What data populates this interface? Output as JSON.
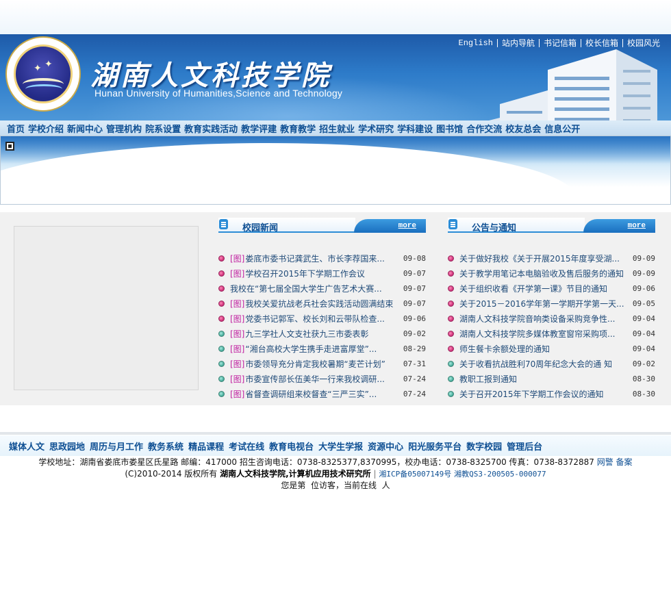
{
  "header": {
    "title_cn": "湖南人文科技学院",
    "title_en": "Hunan University of Humanities,Science and Technology",
    "top_links": [
      "English",
      "站内导航",
      "书记信箱",
      "校长信箱",
      "校园风光"
    ]
  },
  "nav": {
    "items": [
      "首页",
      "学校介绍",
      "新闻中心",
      "管理机构",
      "院系设置",
      "教育实践活动",
      "教学评建",
      "教育教学",
      "招生就业",
      "学术研究",
      "学科建设",
      "图书馆",
      "合作交流",
      "校友总会",
      "信息公开"
    ]
  },
  "news": {
    "title": "校园新闻",
    "more": "more",
    "tag_label": "[图]",
    "items": [
      {
        "tag": true,
        "dot": "red",
        "text": "娄底市委书记龚武生、市长李荐国来...",
        "date": "09-08"
      },
      {
        "tag": true,
        "dot": "red",
        "text": "学校召开2015年下学期工作会议",
        "date": "09-07"
      },
      {
        "tag": false,
        "dot": "red",
        "text": "我校在“第七届全国大学生广告艺术大赛...",
        "date": "09-07"
      },
      {
        "tag": true,
        "dot": "red",
        "text": "我校关爱抗战老兵社会实践活动圆满结束",
        "date": "09-07"
      },
      {
        "tag": true,
        "dot": "red",
        "text": "党委书记郭军、校长刘和云带队检查...",
        "date": "09-06"
      },
      {
        "tag": true,
        "dot": "green",
        "text": "九三学社人文支社获九三市委表彰",
        "date": "09-02"
      },
      {
        "tag": true,
        "dot": "green",
        "text": "“湘台高校大学生携手走进富厚堂”...",
        "date": "08-29"
      },
      {
        "tag": true,
        "dot": "green",
        "text": "市委领导充分肯定我校暑期“麦芒计划”",
        "date": "07-31"
      },
      {
        "tag": true,
        "dot": "green",
        "text": "市委宣传部长伍美华一行来我校调研...",
        "date": "07-24"
      },
      {
        "tag": true,
        "dot": "green",
        "text": "省督查调研组来校督查“三严三实”...",
        "date": "07-24"
      }
    ]
  },
  "notices": {
    "title": "公告与通知",
    "more": "more",
    "items": [
      {
        "dot": "red",
        "text": "关于做好我校《关于开展2015年度享受湖...",
        "date": "09-09"
      },
      {
        "dot": "red",
        "text": "关于教学用笔记本电脑验收及售后服务的通知",
        "date": "09-09"
      },
      {
        "dot": "red",
        "text": "关于组织收看《开学第一课》节目的通知",
        "date": "09-06"
      },
      {
        "dot": "red",
        "text": "关于2015－2016学年第一学期开学第一天...",
        "date": "09-05"
      },
      {
        "dot": "red",
        "text": "湖南人文科技学院音响类设备采购竞争性...",
        "date": "09-04"
      },
      {
        "dot": "red",
        "text": "湖南人文科技学院多媒体教室窗帘采购项...",
        "date": "09-04"
      },
      {
        "dot": "red",
        "text": "师生餐卡余额处理的通知",
        "date": "09-04"
      },
      {
        "dot": "green",
        "text": "关于收看抗战胜利70周年纪念大会的通 知",
        "date": "09-02"
      },
      {
        "dot": "green",
        "text": "教职工报到通知",
        "date": "08-30"
      },
      {
        "dot": "green",
        "text": "关于召开2015年下学期工作会议的通知",
        "date": "08-30"
      }
    ]
  },
  "footer": {
    "nav": [
      "媒体人文",
      "思政园地",
      "周历与月工作",
      "教务系统",
      "精品课程",
      "考试在线",
      "教育电视台",
      "大学生学报",
      "资源中心",
      "阳光服务平台",
      "数字校园",
      "管理后台"
    ],
    "address_line": "学校地址：湖南省娄底市娄星区氐星路 邮编：417000 招生咨询电话：0738-8325377,8370995，校办电话：0738-8325700 传真：0738-8372887",
    "address_links": [
      "网警",
      "备案"
    ],
    "copyright_prefix": "(C)2010-2014 版权所有",
    "copyright_owner": "湖南人文科技学院,计算机应用技术研究所",
    "icp": "湘ICP备05007149号",
    "edu": "湘教QS3-200505-000077",
    "visitor_line": "您是第  位访客，当前在线  人"
  },
  "colors": {
    "accent": "#0e4f93",
    "header_blue": "#2d7bc9",
    "tag_magenta": "#c020a0"
  }
}
